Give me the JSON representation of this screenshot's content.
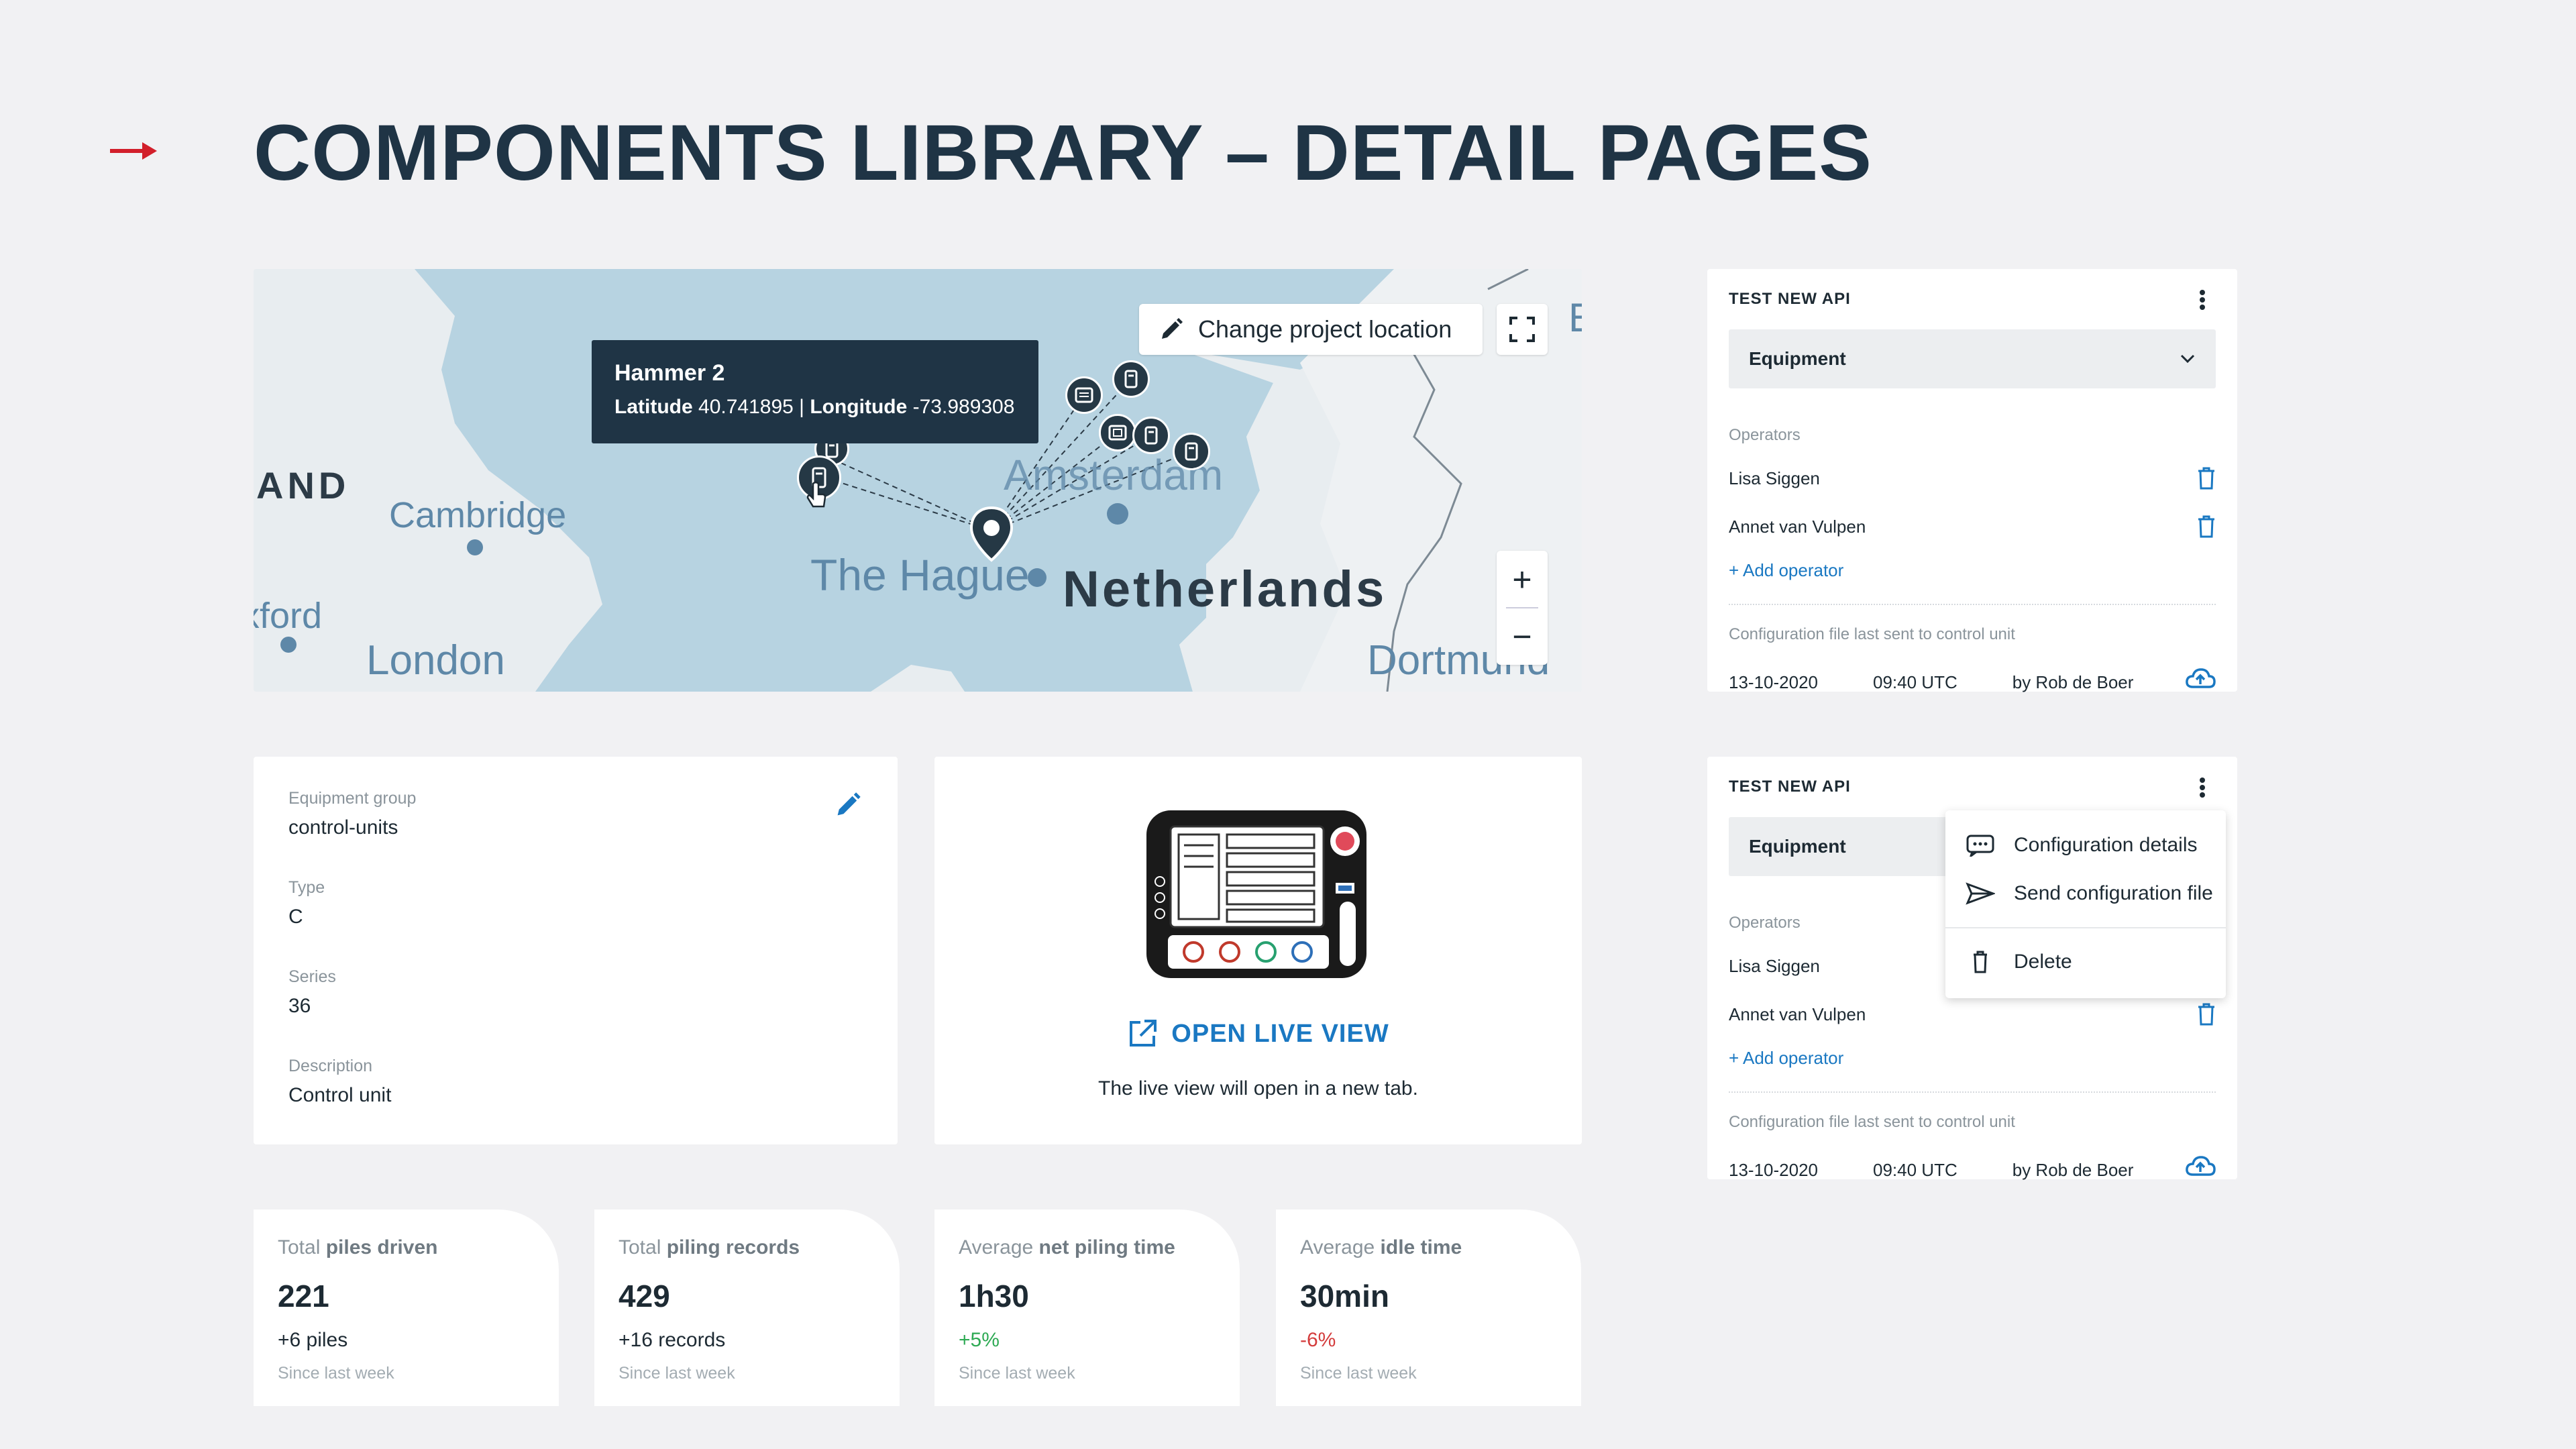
{
  "header": {
    "title": "COMPONENTS LIBRARY – DETAIL PAGES",
    "accent": "#d21f2a"
  },
  "map": {
    "tooltip": {
      "title": "Hammer 2",
      "lat_label": "Latitude",
      "lat": "40.741895",
      "sep": "|",
      "lon_label": "Longitude",
      "lon": "-73.989308"
    },
    "change_location": "Change project location",
    "zoom_in": "+",
    "zoom_out": "−",
    "labels": {
      "land": "AND",
      "cambridge": "Cambridge",
      "oxford": "Oxford",
      "london": "London",
      "hague": "The Hague",
      "netherlands": "Netherlands",
      "amsterdam": "Amsterdam",
      "dortmund": "Dortmund",
      "edge": "E"
    }
  },
  "equipment": {
    "fields": [
      {
        "label": "Equipment group",
        "value": "control-units"
      },
      {
        "label": "Type",
        "value": "C"
      },
      {
        "label": "Series",
        "value": "36"
      },
      {
        "label": "Description",
        "value": "Control unit"
      }
    ]
  },
  "live_view": {
    "link": "OPEN LIVE VIEW",
    "note": "The live view will open in a new tab."
  },
  "stats": [
    {
      "pre": "Total ",
      "bold": "piles driven",
      "value": "221",
      "change": "+6 piles",
      "since": "Since last week",
      "tone": "neutral"
    },
    {
      "pre": "Total ",
      "bold": "piling records",
      "value": "429",
      "change": "+16 records",
      "since": "Since last week",
      "tone": "neutral"
    },
    {
      "pre": "Average ",
      "bold": "net piling time",
      "value": "1h30",
      "change": "+5%",
      "since": "Since last week",
      "tone": "pos"
    },
    {
      "pre": "Average ",
      "bold": "idle time",
      "value": "30min",
      "change": "-6%",
      "since": "Since last week",
      "tone": "neg"
    }
  ],
  "api1": {
    "title": "TEST NEW API",
    "select": "Equipment",
    "operators_label": "Operators",
    "operators": [
      "Lisa Siggen",
      "Annet van Vulpen"
    ],
    "add_operator": "+ Add operator",
    "config_label": "Configuration file last sent to control unit",
    "date": "13-10-2020",
    "time": "09:40 UTC",
    "by": "by Rob de Boer"
  },
  "api2": {
    "title": "TEST NEW API",
    "select": "Equipment",
    "operators_label": "Operators",
    "operators": [
      "Lisa Siggen",
      "Annet van Vulpen"
    ],
    "add_operator": "+ Add operator",
    "config_label": "Configuration file last sent to control unit",
    "date": "13-10-2020",
    "time": "09:40 UTC",
    "by": "by Rob de Boer"
  },
  "menu": {
    "items": [
      "Configuration details",
      "Send configuration file",
      "Delete"
    ]
  },
  "colors": {
    "primary": "#1f3445",
    "link": "#1a78c2",
    "positive": "#2eaa54",
    "negative": "#d43c3c"
  }
}
